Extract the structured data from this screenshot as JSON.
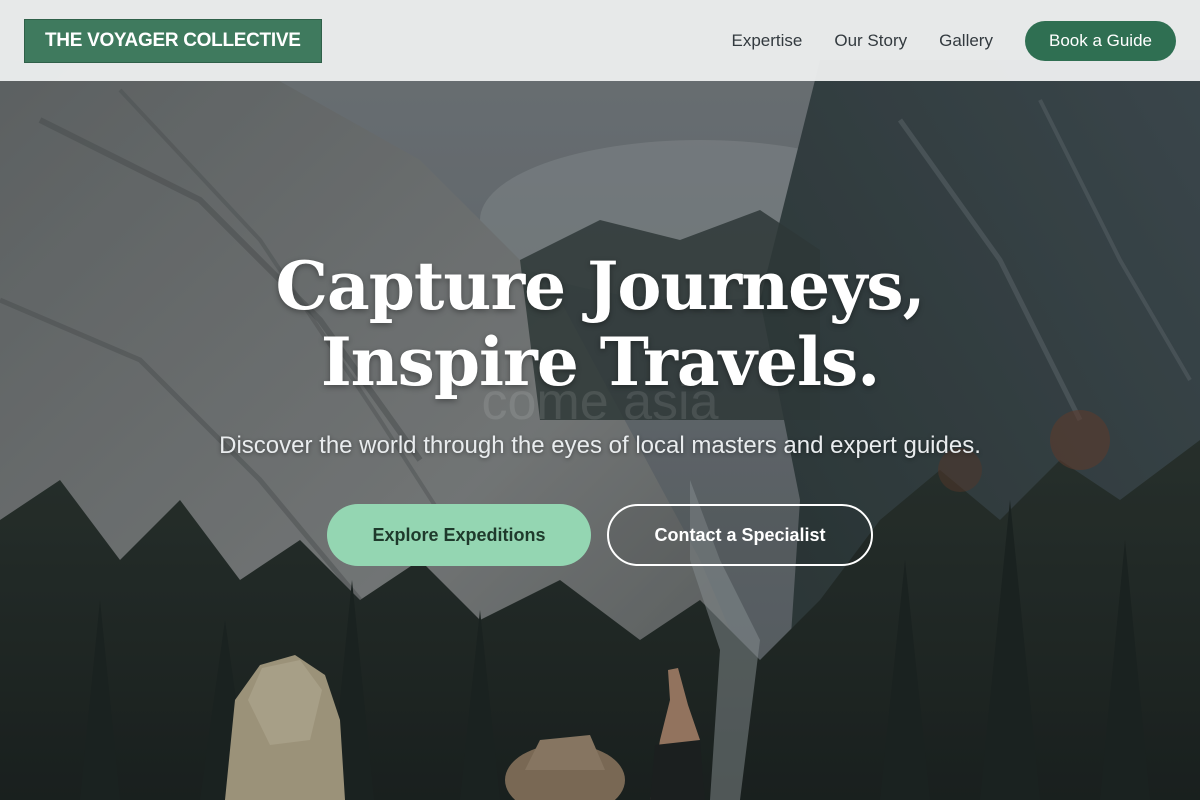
{
  "header": {
    "brand": "THE VOYAGER COLLECTIVE",
    "nav": [
      {
        "label": "Expertise"
      },
      {
        "label": "Our Story"
      },
      {
        "label": "Gallery"
      }
    ],
    "cta_label": "Book a Guide"
  },
  "hero": {
    "title": "Capture Journeys, Inspire Travels.",
    "subtitle": "Discover the world through the eyes of local masters and expert guides.",
    "watermark": "come asia",
    "primary_label": "Explore Expeditions",
    "secondary_label": "Contact a Specialist"
  },
  "colors": {
    "brand_green": "#3f7a5e",
    "cta_green": "#2f6f52",
    "primary_button": "#94d6b2",
    "header_bg": "#eceeee"
  }
}
